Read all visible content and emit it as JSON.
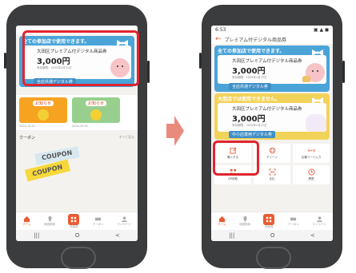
{
  "left_phone": {
    "voucher": {
      "top_text": "全ての参加店で使用できます。",
      "name": "大田区プレミアム付デジタル商品券",
      "amount": "3,000円",
      "expiry": "有効期限：2025年1月31日",
      "badge": "全店共通デジタル券"
    },
    "notices": [
      {
        "tag": "お知らせ",
        "date": "2024.10.01",
        "color": "#f5a321"
      },
      {
        "tag": "お知らせ",
        "date": "2024.10.01",
        "color": "#98cf8f"
      }
    ],
    "coupon_section": {
      "title": "クーポン",
      "more": "すべて見る",
      "ticket_text": "COUPON",
      "ticket_back_text": "COUPON"
    },
    "tabs": [
      "ホーム",
      "地図検索",
      "商品券",
      "クーポン",
      "マイページ"
    ],
    "nav": [
      "|||",
      "O",
      "<"
    ]
  },
  "right_phone": {
    "status": {
      "time": "6:53",
      "icons": "▣ ▲ ◼"
    },
    "header_title": "プレミアム付デジタル商品券",
    "voucher1": {
      "top_text": "全ての参加店で使用できます。",
      "name": "大田区プレミアム付デジタル商品券",
      "amount": "3,000円",
      "expiry": "有効期限：2025年1月31日",
      "badge": "全店共通デジタル券"
    },
    "voucher2": {
      "top_text": "大型店では使用できません。",
      "name": "大田区プレミアム付デジタル商品券",
      "amount": "3,000円",
      "expiry": "有効期限：2025年1月31日",
      "badge": "中小店専用デジタル券"
    },
    "grid": [
      {
        "label": "購入する",
        "icon": "edit-icon"
      },
      {
        "label": "チャージ",
        "icon": "plus-icon"
      },
      {
        "label": "店舗コード入力",
        "icon": "code-icon"
      },
      {
        "label": "QR読取",
        "icon": "qr-icon"
      },
      {
        "label": "支払",
        "icon": "scan-icon"
      },
      {
        "label": "履歴",
        "icon": "clock-icon"
      }
    ],
    "tabs": [
      "ホーム",
      "地図検索",
      "商品券",
      "クーポン",
      "マイページ"
    ],
    "nav": [
      "|||",
      "O",
      "<"
    ]
  },
  "colors": {
    "accent": "#e85c33",
    "highlight": "#e0242e",
    "voucher_blue": "#4aa4d8",
    "voucher_yellow": "#f2d35a",
    "phone_body": "#3b3c3e",
    "arrow": "#e98a7f"
  }
}
